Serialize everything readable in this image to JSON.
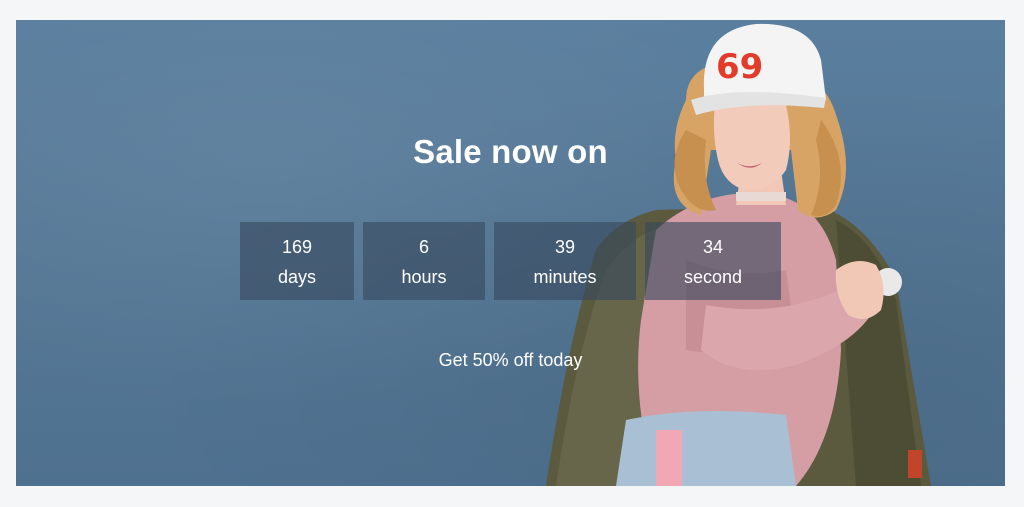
{
  "banner": {
    "headline": "Sale now on",
    "subline": "Get 50% off today",
    "cap_text": "69",
    "background_color": "#567a9a"
  },
  "countdown": [
    {
      "value": "169",
      "unit": "days"
    },
    {
      "value": "6",
      "unit": "hours"
    },
    {
      "value": "39",
      "unit": "minutes"
    },
    {
      "value": "34",
      "unit": "second"
    }
  ]
}
